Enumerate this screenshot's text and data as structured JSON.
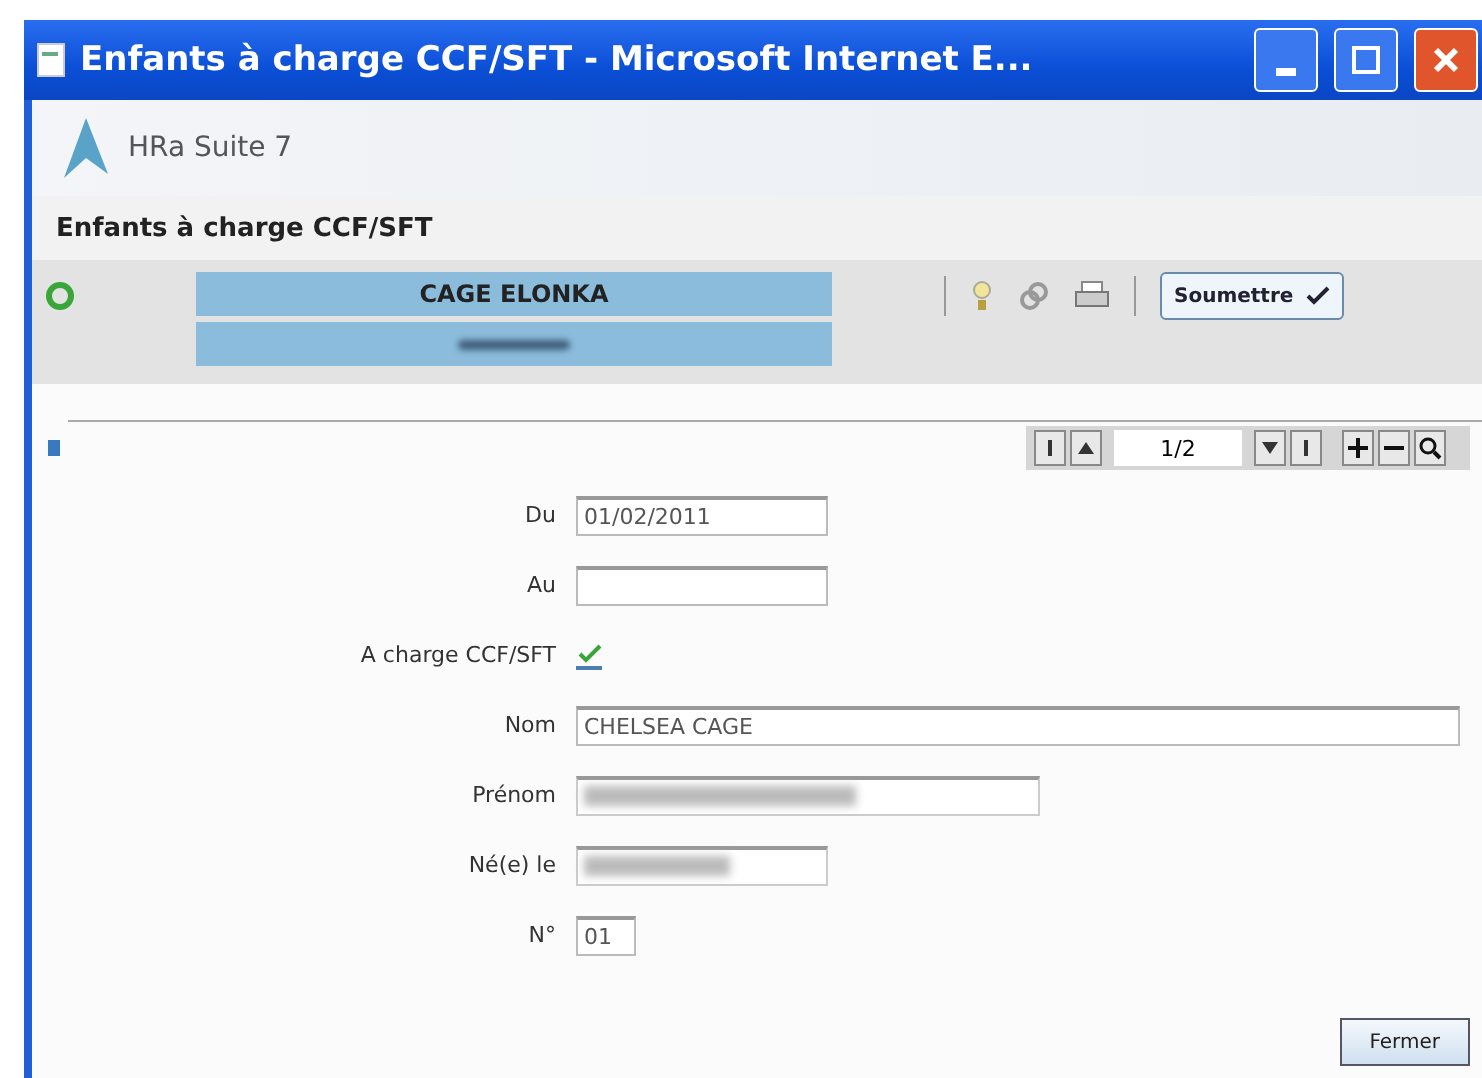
{
  "window": {
    "title": "Enfants à charge CCF/SFT - Microsoft Internet E..."
  },
  "app": {
    "name": "HRa Suite 7"
  },
  "page_title": "Enfants à charge CCF/SFT",
  "employee": {
    "name": "CAGE ELONKA"
  },
  "toolbar": {
    "submit": "Soumettre"
  },
  "pager": {
    "position": "1/2"
  },
  "fields": [
    {
      "kind": "text",
      "label": "Du",
      "value": "01/02/2011"
    },
    {
      "kind": "text",
      "label": "Au"
    },
    {
      "kind": "checkbox",
      "label": "A charge CCF/SFT",
      "checked": true
    },
    {
      "kind": "text",
      "label": "Nom",
      "value": "CHELSEA CAGE"
    },
    {
      "kind": "redacted",
      "label": "Prénom"
    },
    {
      "kind": "redacted",
      "label": "Né(e) le"
    },
    {
      "kind": "text",
      "label": "N°",
      "value": "01"
    }
  ],
  "buttons": [
    "Fermer"
  ]
}
